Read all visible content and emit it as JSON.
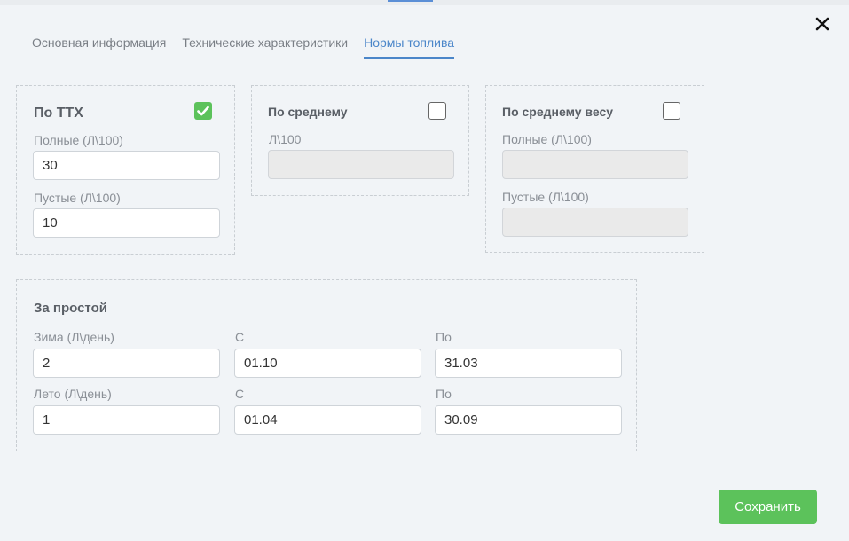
{
  "tabs": [
    {
      "label": "Основная информация",
      "active": false
    },
    {
      "label": "Технические характеристики",
      "active": false
    },
    {
      "label": "Нормы топлива",
      "active": true
    }
  ],
  "by_ttx": {
    "title": "По ТТХ",
    "checked": true,
    "full_label": "Полные (Л\\100)",
    "full_value": "30",
    "empty_label": "Пустые (Л\\100)",
    "empty_value": "10"
  },
  "by_average": {
    "title": "По среднему",
    "checked": false,
    "value_label": "Л\\100",
    "value": ""
  },
  "by_average_weight": {
    "title": "По среднему весу",
    "checked": false,
    "full_label": "Полные (Л\\100)",
    "full_value": "",
    "empty_label": "Пустые (Л\\100)",
    "empty_value": ""
  },
  "idle": {
    "title": "За простой",
    "winter_label": "Зима (Л\\день)",
    "winter_value": "2",
    "winter_from_label": "С",
    "winter_from_value": "01.10",
    "winter_to_label": "По",
    "winter_to_value": "31.03",
    "summer_label": "Лето (Л\\день)",
    "summer_value": "1",
    "summer_from_label": "С",
    "summer_from_value": "01.04",
    "summer_to_label": "По",
    "summer_to_value": "30.09"
  },
  "save_label": "Сохранить",
  "colors": {
    "accent": "#4b86c9",
    "success": "#5cc25b",
    "background": "#f1f4f7"
  }
}
